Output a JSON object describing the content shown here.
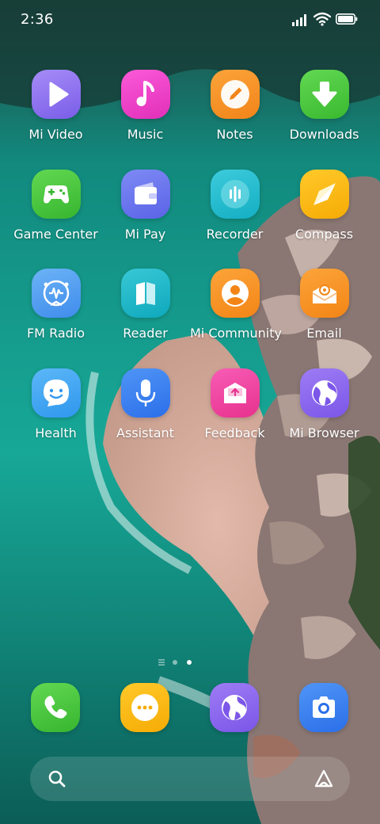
{
  "status_bar": {
    "time": "2:36",
    "icons": [
      "signal-icon",
      "wifi-icon",
      "battery-icon"
    ]
  },
  "apps": [
    {
      "label": "Mi Video",
      "icon": "play-icon",
      "color": "#8a6cf0"
    },
    {
      "label": "Music",
      "icon": "music-note-icon",
      "color": "#f23fc8"
    },
    {
      "label": "Notes",
      "icon": "pencil-icon",
      "color": "#f7911f"
    },
    {
      "label": "Downloads",
      "icon": "download-arrow-icon",
      "color": "#48c93a"
    },
    {
      "label": "Game Center",
      "icon": "gamepad-icon",
      "color": "#45c640"
    },
    {
      "label": "Mi Pay",
      "icon": "wallet-icon",
      "color": "#6f79ee"
    },
    {
      "label": "Recorder",
      "icon": "waveform-icon",
      "color": "#23bcd1"
    },
    {
      "label": "Compass",
      "icon": "compass-needle-icon",
      "color": "#fcb90d"
    },
    {
      "label": "FM Radio",
      "icon": "radio-icon",
      "color": "#4f9cf2"
    },
    {
      "label": "Reader",
      "icon": "book-icon",
      "color": "#19b8c9"
    },
    {
      "label": "Mi Community",
      "icon": "community-user-icon",
      "color": "#f98d1e"
    },
    {
      "label": "Email",
      "icon": "email-icon",
      "color": "#f98d1e"
    },
    {
      "label": "Health",
      "icon": "smile-chat-icon",
      "color": "#3ea8f4"
    },
    {
      "label": "Assistant",
      "icon": "microphone-icon",
      "color": "#3680f2"
    },
    {
      "label": "Feedback",
      "icon": "feedback-inbox-icon",
      "color": "#f0409d"
    },
    {
      "label": "Mi Browser",
      "icon": "globe-icon",
      "color": "#8a63ee"
    }
  ],
  "page_indicator": {
    "pages": 2,
    "current": 2
  },
  "dock": [
    {
      "label": "Phone",
      "icon": "phone-icon",
      "color": "#45c640"
    },
    {
      "label": "Messages",
      "icon": "chat-dots-icon",
      "color": "#fcb90d"
    },
    {
      "label": "Browser",
      "icon": "globe-icon",
      "color": "#8a63ee"
    },
    {
      "label": "Camera",
      "icon": "camera-icon",
      "color": "#3a86f2"
    }
  ],
  "search": {
    "search_icon": "search-icon",
    "assistant_icon": "assistant-triangle-icon"
  }
}
